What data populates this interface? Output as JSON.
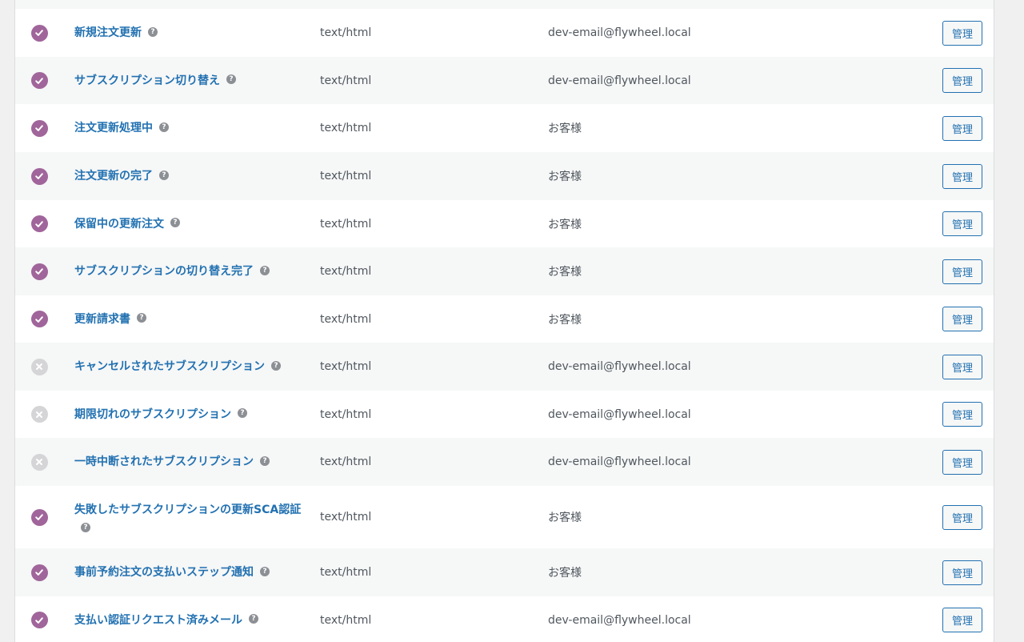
{
  "emails": [
    {
      "enabled": true,
      "name": "新規注文更新",
      "content_type": "text/html",
      "recipient": "dev-email@flywheel.local",
      "manage": "管理"
    },
    {
      "enabled": true,
      "name": "サブスクリプション切り替え",
      "content_type": "text/html",
      "recipient": "dev-email@flywheel.local",
      "manage": "管理"
    },
    {
      "enabled": true,
      "name": "注文更新処理中",
      "content_type": "text/html",
      "recipient": "お客様",
      "manage": "管理"
    },
    {
      "enabled": true,
      "name": "注文更新の完了",
      "content_type": "text/html",
      "recipient": "お客様",
      "manage": "管理"
    },
    {
      "enabled": true,
      "name": "保留中の更新注文",
      "content_type": "text/html",
      "recipient": "お客様",
      "manage": "管理"
    },
    {
      "enabled": true,
      "name": "サブスクリプションの切り替え完了",
      "content_type": "text/html",
      "recipient": "お客様",
      "manage": "管理"
    },
    {
      "enabled": true,
      "name": "更新請求書",
      "content_type": "text/html",
      "recipient": "お客様",
      "manage": "管理"
    },
    {
      "enabled": false,
      "name": "キャンセルされたサブスクリプション",
      "content_type": "text/html",
      "recipient": "dev-email@flywheel.local",
      "manage": "管理"
    },
    {
      "enabled": false,
      "name": "期限切れのサブスクリプション",
      "content_type": "text/html",
      "recipient": "dev-email@flywheel.local",
      "manage": "管理"
    },
    {
      "enabled": false,
      "name": "一時中断されたサブスクリプション",
      "content_type": "text/html",
      "recipient": "dev-email@flywheel.local",
      "manage": "管理"
    },
    {
      "enabled": true,
      "name": "失敗したサブスクリプションの更新SCA認証",
      "content_type": "text/html",
      "recipient": "お客様",
      "manage": "管理"
    },
    {
      "enabled": true,
      "name": "事前予約注文の支払いステップ通知",
      "content_type": "text/html",
      "recipient": "お客様",
      "manage": "管理"
    },
    {
      "enabled": true,
      "name": "支払い認証リクエスト済みメール",
      "content_type": "text/html",
      "recipient": "dev-email@flywheel.local",
      "manage": "管理"
    }
  ],
  "help_glyph": "?",
  "icons": {
    "enabled": "checkmark-icon",
    "disabled": "cross-icon",
    "help": "help-icon"
  },
  "colors": {
    "enabled": "#a0659a",
    "disabled": "#d5d5d7",
    "link": "#2271b1"
  }
}
